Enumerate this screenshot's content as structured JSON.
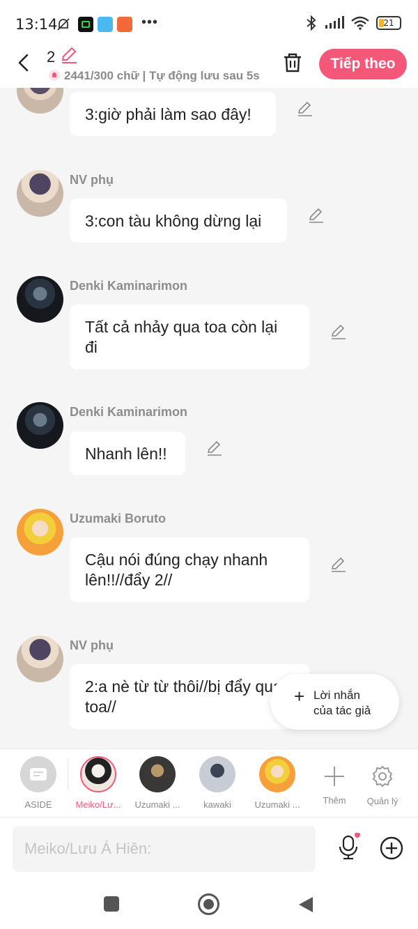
{
  "status_bar": {
    "time": "13:14",
    "battery": "21"
  },
  "header": {
    "episode_number": "2",
    "word_count": "2441/300 chữ | Tự động lưu sau 5s",
    "next_button": "Tiếp theo"
  },
  "messages": [
    {
      "name": "",
      "text": "3:giờ phải làm sao đây!",
      "avatar": "side-character-avatar"
    },
    {
      "name": "NV phụ",
      "text": "3:con tàu không dừng lại",
      "avatar": "side-character-avatar"
    },
    {
      "name": "Denki Kaminarimon",
      "text": "Tất cả nhảy qua toa còn lại đi",
      "avatar": "denki-avatar"
    },
    {
      "name": "Denki Kaminarimon",
      "text": "Nhanh lên!!",
      "avatar": "denki-avatar"
    },
    {
      "name": "Uzumaki Boruto",
      "text": "Cậu nói đúng chạy nhanh lên!!//đẩy 2//",
      "avatar": "boruto-avatar"
    },
    {
      "name": "NV phụ",
      "text": "2:a nè từ từ thôi//bị đẩy qua toa//",
      "avatar": "side-character-avatar"
    }
  ],
  "author_note": {
    "line1": "Lời nhắn",
    "line2": "của tác giả"
  },
  "characters": [
    {
      "label": "ASIDE"
    },
    {
      "label": "Meiko/Lư...",
      "active": true
    },
    {
      "label": "Uzumaki ..."
    },
    {
      "label": "kawaki"
    },
    {
      "label": "Uzumaki ..."
    }
  ],
  "tools": {
    "add": "Thêm",
    "manage": "Quản lý"
  },
  "input": {
    "placeholder": "Meiko/Lưu Á Hiên:"
  },
  "colors": {
    "accent": "#f45777",
    "bg": "#f5f5f5"
  }
}
